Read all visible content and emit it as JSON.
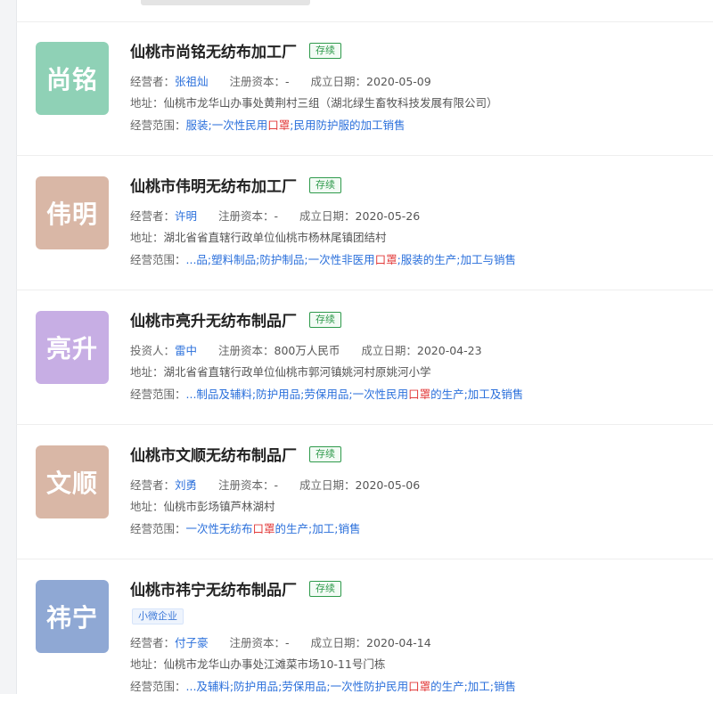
{
  "labels": {
    "operator": "经营者：",
    "investor": "投资人：",
    "capital": "注册资本：",
    "founded": "成立日期：",
    "address": "地址：",
    "scope": "经营范围："
  },
  "colors": {
    "status_green": "#2f9a4c",
    "link_blue": "#2a6fdb",
    "highlight_red": "#e23b3b"
  },
  "companies": [
    {
      "logo_text": "尚铭",
      "logo_color": "#8fd1b6",
      "name": "仙桃市尚铭无纺布加工厂",
      "status": "存续",
      "person_label": "经营者：",
      "person": "张祖灿",
      "capital": "-",
      "founded": "2020-05-09",
      "address": "仙桃市龙华山办事处黄荆村三组（湖北绿生畜牧科技发展有限公司）",
      "scope_pre": "服装;一次性民用",
      "scope_hl": "口罩",
      "scope_post": ";民用防护服的加工销售"
    },
    {
      "logo_text": "伟明",
      "logo_color": "#d9b7a6",
      "name": "仙桃市伟明无纺布加工厂",
      "status": "存续",
      "person_label": "经营者：",
      "person": "许明",
      "capital": "-",
      "founded": "2020-05-26",
      "address": "湖北省省直辖行政单位仙桃市杨林尾镇团结村",
      "scope_pre": "...品;塑料制品;防护制品;一次性非医用",
      "scope_hl": "口罩",
      "scope_post": ";服装的生产;加工与销售"
    },
    {
      "logo_text": "亮升",
      "logo_color": "#c7aee4",
      "name": "仙桃市亮升无纺布制品厂",
      "status": "存续",
      "person_label": "投资人：",
      "person": "雷中",
      "capital": "800万人民币",
      "founded": "2020-04-23",
      "address": "湖北省省直辖行政单位仙桃市郭河镇姚河村原姚河小学",
      "scope_pre": "...制品及辅料;防护用品;劳保用品;一次性民用",
      "scope_hl": "口罩",
      "scope_post": "的生产;加工及销售"
    },
    {
      "logo_text": "文顺",
      "logo_color": "#d9b7a6",
      "name": "仙桃市文顺无纺布制品厂",
      "status": "存续",
      "person_label": "经营者：",
      "person": "刘勇",
      "capital": "-",
      "founded": "2020-05-06",
      "address": "仙桃市彭场镇芦林湖村",
      "scope_pre": "一次性无纺布",
      "scope_hl": "口罩",
      "scope_post": "的生产;加工;销售"
    },
    {
      "logo_text": "祎宁",
      "logo_color": "#8fa8d4",
      "name": "仙桃市祎宁无纺布制品厂",
      "status": "存续",
      "tag": "小微企业",
      "person_label": "经营者：",
      "person": "付子豪",
      "capital": "-",
      "founded": "2020-04-14",
      "address": "仙桃市龙华山办事处江滩菜市场10-11号门栋",
      "scope_pre": "...及辅料;防护用品;劳保用品;一次性防护民用",
      "scope_hl": "口罩",
      "scope_post": "的生产;加工;销售"
    }
  ]
}
